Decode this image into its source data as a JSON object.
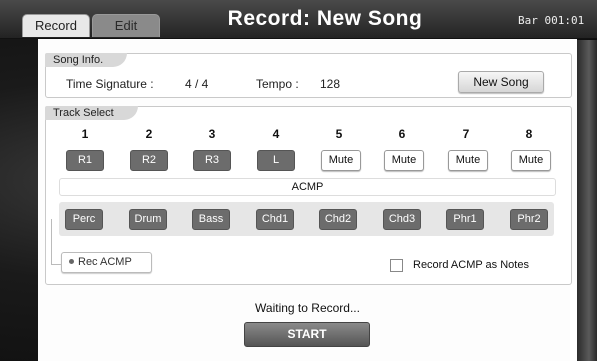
{
  "tabs": [
    {
      "label": "Record"
    },
    {
      "label": "Edit"
    }
  ],
  "title": "Record: New Song",
  "bar_readout": "Bar 001:01",
  "song_info": {
    "label": "Song Info.",
    "time_signature_label": "Time Signature :",
    "time_signature_value": "4 / 4",
    "tempo_label": "Tempo :",
    "tempo_value": "128",
    "new_song_button": "New Song"
  },
  "track_select": {
    "label": "Track Select",
    "numbers": [
      "1",
      "2",
      "3",
      "4",
      "5",
      "6",
      "7",
      "8"
    ],
    "tracks": [
      {
        "label": "R1",
        "state": "active"
      },
      {
        "label": "R2",
        "state": "active"
      },
      {
        "label": "R3",
        "state": "active"
      },
      {
        "label": "L",
        "state": "active"
      },
      {
        "label": "Mute",
        "state": "mute"
      },
      {
        "label": "Mute",
        "state": "mute"
      },
      {
        "label": "Mute",
        "state": "mute"
      },
      {
        "label": "Mute",
        "state": "mute"
      }
    ],
    "acmp_label": "ACMP",
    "acmp_parts": [
      "Perc",
      "Drum",
      "Bass",
      "Chd1",
      "Chd2",
      "Chd3",
      "Phr1",
      "Phr2"
    ],
    "rec_acmp_button": "Rec ACMP",
    "record_acmp_as_notes_label": "Record ACMP as Notes",
    "record_acmp_as_notes_checked": false
  },
  "status_text": "Waiting to Record...",
  "start_button": "START"
}
